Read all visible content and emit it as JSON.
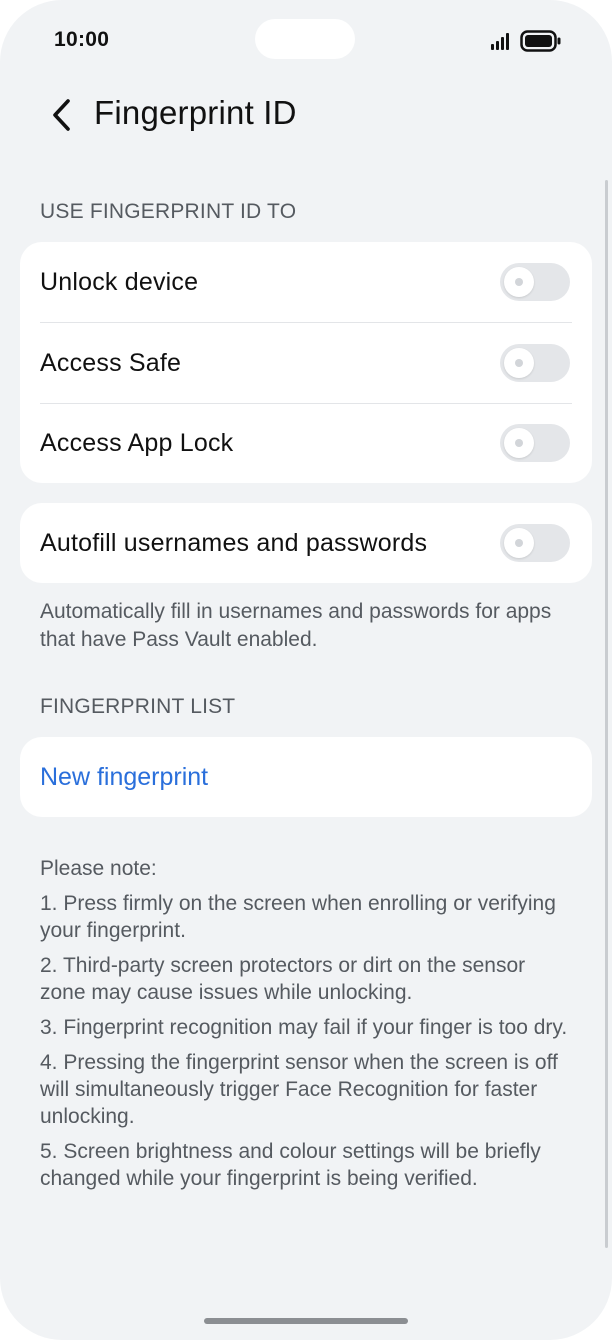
{
  "status_bar": {
    "time": "10:00"
  },
  "header": {
    "title": "Fingerprint ID",
    "back_icon": "chevron-left-icon"
  },
  "use_section": {
    "header": "USE FINGERPRINT ID TO",
    "items": [
      {
        "label": "Unlock device",
        "enabled": false
      },
      {
        "label": "Access Safe",
        "enabled": false
      },
      {
        "label": "Access App Lock",
        "enabled": false
      }
    ]
  },
  "autofill": {
    "label": "Autofill usernames and passwords",
    "enabled": false,
    "helper": "Automatically fill in usernames and passwords for apps that have Pass Vault enabled."
  },
  "fingerprint_list": {
    "header": "FINGERPRINT LIST",
    "new_label": "New fingerprint"
  },
  "notes": {
    "title": "Please note:",
    "items": [
      "1. Press firmly on the screen when enrolling or verifying your fingerprint.",
      "2. Third-party screen protectors or dirt on the sensor zone may cause issues while unlocking.",
      "3. Fingerprint recognition may fail if your finger is too dry.",
      "4. Pressing the fingerprint sensor when the screen is off will simultaneously trigger Face Recognition for faster unlocking.",
      "5. Screen brightness and colour settings will be briefly changed while your fingerprint is being verified."
    ]
  },
  "colors": {
    "background": "#f1f3f5",
    "card": "#ffffff",
    "link": "#2a6fdb",
    "toggle_off": "#e4e6e9"
  }
}
